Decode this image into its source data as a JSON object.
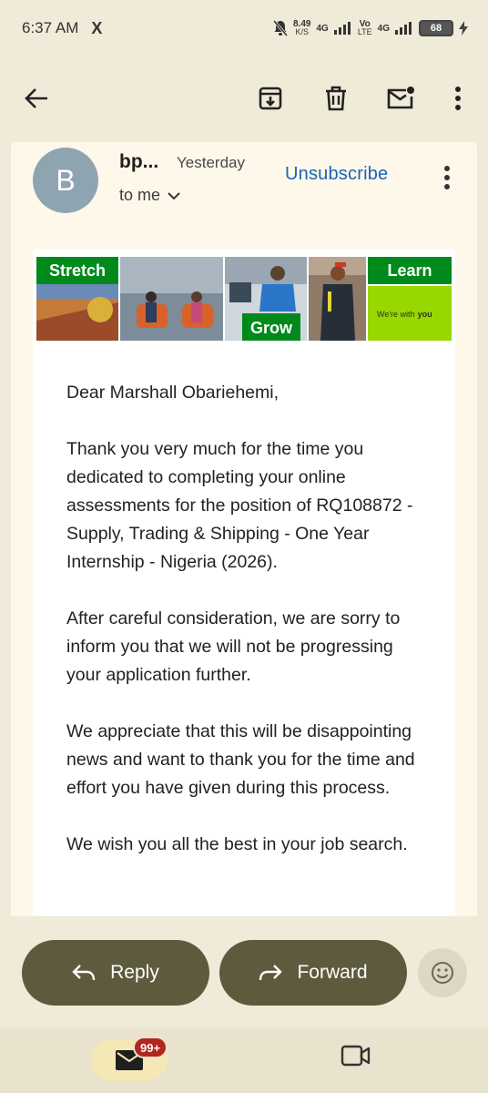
{
  "status_bar": {
    "time": "6:37 AM",
    "x_label": "X",
    "speed_value": "8.49",
    "speed_unit": "K/S",
    "net1": "4G",
    "net2_top": "Vo",
    "net2_bottom": "LTE",
    "net3": "4G",
    "battery": "68"
  },
  "app_bar": {
    "back_icon": "arrow-back-icon",
    "archive_icon": "archive-icon",
    "delete_icon": "trash-icon",
    "unread_icon": "mark-unread-icon",
    "more_icon": "more-vert-icon"
  },
  "email": {
    "avatar_letter": "B",
    "sender": "bp...",
    "date": "Yesterday",
    "recipient": "to me",
    "unsubscribe_label": "Unsubscribe",
    "banner": {
      "tag_stretch": "Stretch",
      "tag_grow": "Grow",
      "tag_learn": "Learn",
      "tagline_prefix": "We're with",
      "tagline_brand": "you"
    },
    "paragraphs": [
      "Dear Marshall Obariehemi,",
      "Thank you very much for the time you dedicated to completing your online assessments for the position of RQ108872 - Supply, Trading & Shipping - One Year Internship - Nigeria (2026).",
      "After careful consideration, we are sorry to inform you that we will not be progressing your application further.",
      "We appreciate that this will be disappointing news and want to thank you for the time and effort you have given during this process.",
      "We wish you all the best in your job search."
    ]
  },
  "actions": {
    "reply_label": "Reply",
    "forward_label": "Forward"
  },
  "bottom_nav": {
    "mail_badge": "99+"
  },
  "colors": {
    "background": "#f0ead8",
    "pill": "#5e5a3e",
    "link": "#1a63b8",
    "banner_green": "#008a1c",
    "banner_lime": "#99d700",
    "badge": "#b3261e"
  }
}
